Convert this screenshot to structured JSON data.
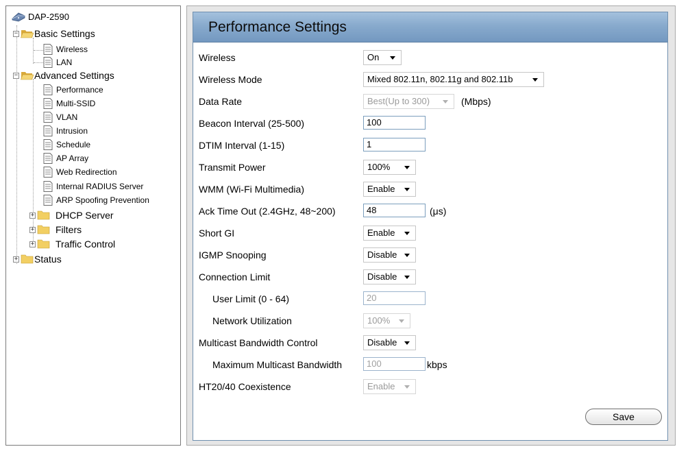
{
  "tree": {
    "root": "DAP-2590",
    "basic": {
      "label": "Basic Settings",
      "items": [
        "Wireless",
        "LAN"
      ]
    },
    "advanced": {
      "label": "Advanced Settings",
      "items": [
        "Performance",
        "Multi-SSID",
        "VLAN",
        "Intrusion",
        "Schedule",
        "AP Array",
        "Web Redirection",
        "Internal RADIUS Server",
        "ARP Spoofing Prevention"
      ],
      "folders": [
        "DHCP Server",
        "Filters",
        "Traffic Control"
      ]
    },
    "status": "Status"
  },
  "panel": {
    "title": "Performance Settings",
    "fields": {
      "wireless": {
        "label": "Wireless",
        "value": "On"
      },
      "wireless_mode": {
        "label": "Wireless Mode",
        "value": "Mixed 802.11n, 802.11g and 802.11b"
      },
      "data_rate": {
        "label": "Data Rate",
        "value": "Best(Up to 300)",
        "unit": "(Mbps)"
      },
      "beacon_interval": {
        "label": "Beacon Interval (25-500)",
        "value": "100"
      },
      "dtim_interval": {
        "label": "DTIM Interval (1-15)",
        "value": "1"
      },
      "transmit_power": {
        "label": "Transmit Power",
        "value": "100%"
      },
      "wmm": {
        "label": "WMM (Wi-Fi Multimedia)",
        "value": "Enable"
      },
      "ack_timeout": {
        "label": "Ack Time Out (2.4GHz, 48~200)",
        "value": "48",
        "unit": "(μs)"
      },
      "short_gi": {
        "label": "Short GI",
        "value": "Enable"
      },
      "igmp_snooping": {
        "label": "IGMP Snooping",
        "value": "Disable"
      },
      "connection_limit": {
        "label": "Connection Limit",
        "value": "Disable"
      },
      "user_limit": {
        "label": "User Limit (0 - 64)",
        "value": "20"
      },
      "network_utilization": {
        "label": "Network Utilization",
        "value": "100%"
      },
      "multicast_bw_control": {
        "label": "Multicast Bandwidth Control",
        "value": "Disable"
      },
      "max_multicast_bw": {
        "label": "Maximum Multicast Bandwidth",
        "value": "100",
        "unit": "kbps"
      },
      "ht2040": {
        "label": "HT20/40 Coexistence",
        "value": "Enable"
      }
    },
    "save_label": "Save"
  },
  "colors": {
    "title_bar": "#88aacd",
    "panel_border": "#6f8fae",
    "folder": "#e8c75a"
  }
}
